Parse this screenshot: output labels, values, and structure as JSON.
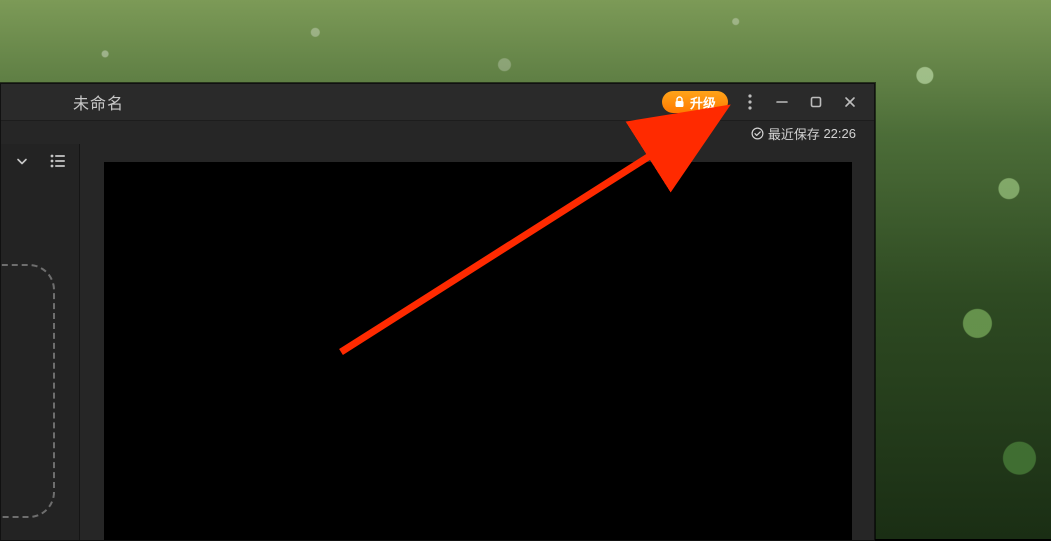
{
  "window": {
    "title": "未命名",
    "upgrade_label": "升级"
  },
  "status": {
    "last_saved_prefix": "最近保存",
    "last_saved_time": "22:26"
  }
}
